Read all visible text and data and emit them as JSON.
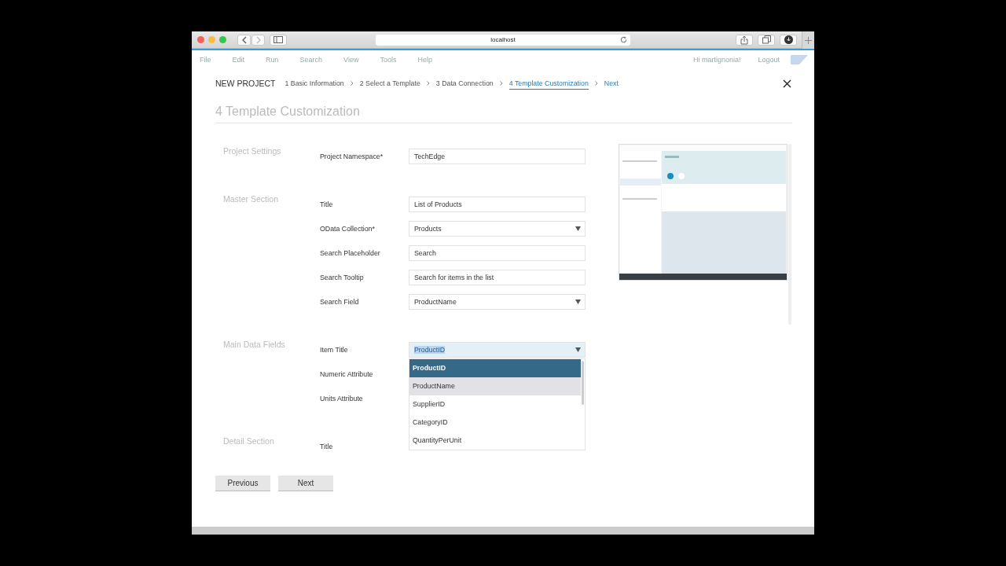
{
  "browser": {
    "url": "localhost"
  },
  "menu": {
    "items": [
      "File",
      "Edit",
      "Run",
      "Search",
      "View",
      "Tools",
      "Help"
    ],
    "user": "Hi martignonia!",
    "logout": "Logout"
  },
  "wizard": {
    "title": "NEW PROJECT",
    "steps": [
      {
        "label": "1 Basic Information",
        "selected": false
      },
      {
        "label": "2 Select a Template",
        "selected": false
      },
      {
        "label": "3 Data Connection",
        "selected": false
      },
      {
        "label": "4 Template Customization",
        "selected": true
      }
    ],
    "next": "Next"
  },
  "heading": "4 Template Customization",
  "sections": [
    {
      "title": "Project Settings",
      "fields": [
        {
          "label": "Project Namespace*",
          "kind": "text",
          "value": "TechEdge"
        }
      ]
    },
    {
      "title": "Master Section",
      "fields": [
        {
          "label": "Title",
          "kind": "text",
          "value": "List of Products"
        },
        {
          "label": "OData Collection*",
          "kind": "select",
          "value": "Products"
        },
        {
          "label": "Search Placeholder",
          "kind": "text",
          "value": "Search"
        },
        {
          "label": "Search Tooltip",
          "kind": "text",
          "value": "Search for items in the list"
        },
        {
          "label": "Search Field",
          "kind": "select",
          "value": "ProductName"
        }
      ]
    },
    {
      "title": "Main Data Fields",
      "fields": [
        {
          "label": "Item Title",
          "kind": "select",
          "value": "ProductID",
          "open": true,
          "options": [
            {
              "label": "ProductID",
              "selected": true,
              "hovered": false
            },
            {
              "label": "ProductName",
              "selected": false,
              "hovered": true
            },
            {
              "label": "SupplierID",
              "selected": false,
              "hovered": false
            },
            {
              "label": "CategoryID",
              "selected": false,
              "hovered": false
            },
            {
              "label": "QuantityPerUnit",
              "selected": false,
              "hovered": false
            }
          ]
        },
        {
          "label": "Numeric Attribute",
          "kind": "hidden"
        },
        {
          "label": "Units Attribute",
          "kind": "hidden"
        }
      ]
    },
    {
      "title": "Detail Section",
      "fields": [
        {
          "label": "Title",
          "kind": "hidden"
        }
      ]
    }
  ],
  "preview": {
    "kind": "picture"
  },
  "buttons": [
    "Previous",
    "Next"
  ]
}
